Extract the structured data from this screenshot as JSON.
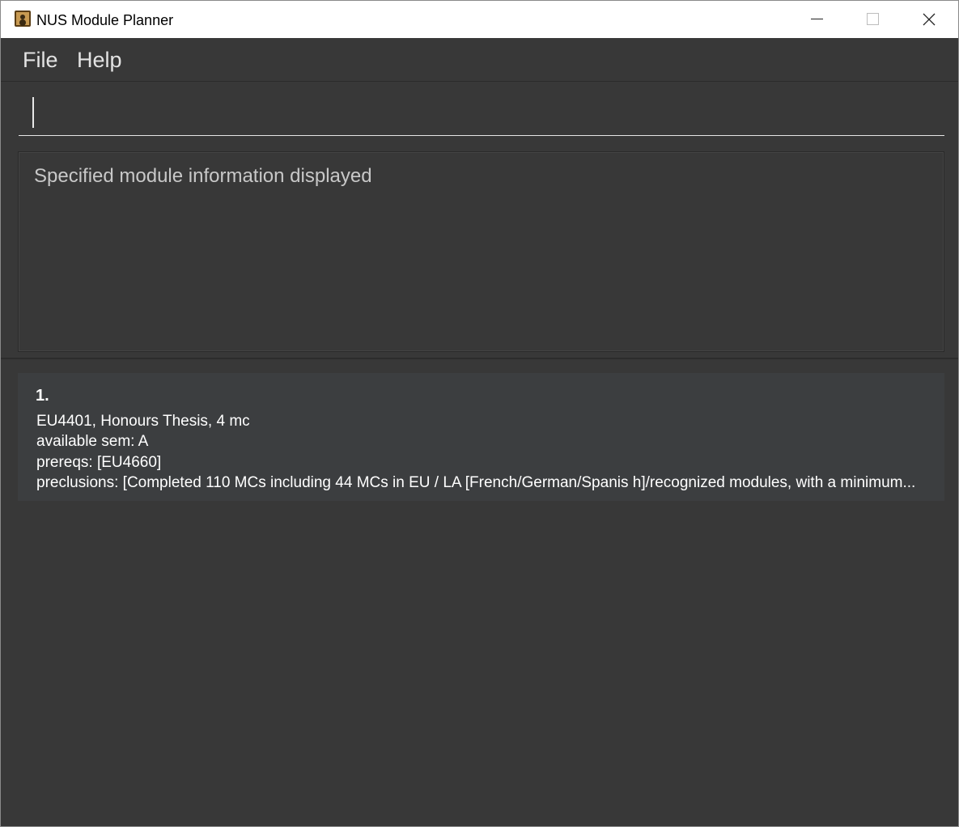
{
  "window": {
    "title": "NUS Module Planner"
  },
  "menu": {
    "file": "File",
    "help": "Help"
  },
  "command": {
    "value": "",
    "placeholder": ""
  },
  "result": {
    "message": "Specified module information displayed"
  },
  "modules": [
    {
      "index": "1.",
      "summary": "EU4401, Honours Thesis, 4 mc",
      "available_sem": "available sem: A",
      "prereqs": "prereqs: [EU4660]",
      "preclusions": "preclusions: [Completed 110 MCs including 44 MCs in EU / LA [French/German/Spanis h]/recognized modules, with a minimum..."
    }
  ],
  "colors": {
    "background": "#383838",
    "card": "#3c3e40",
    "text": "#ffffff",
    "muted_text": "#c8c8c8"
  }
}
